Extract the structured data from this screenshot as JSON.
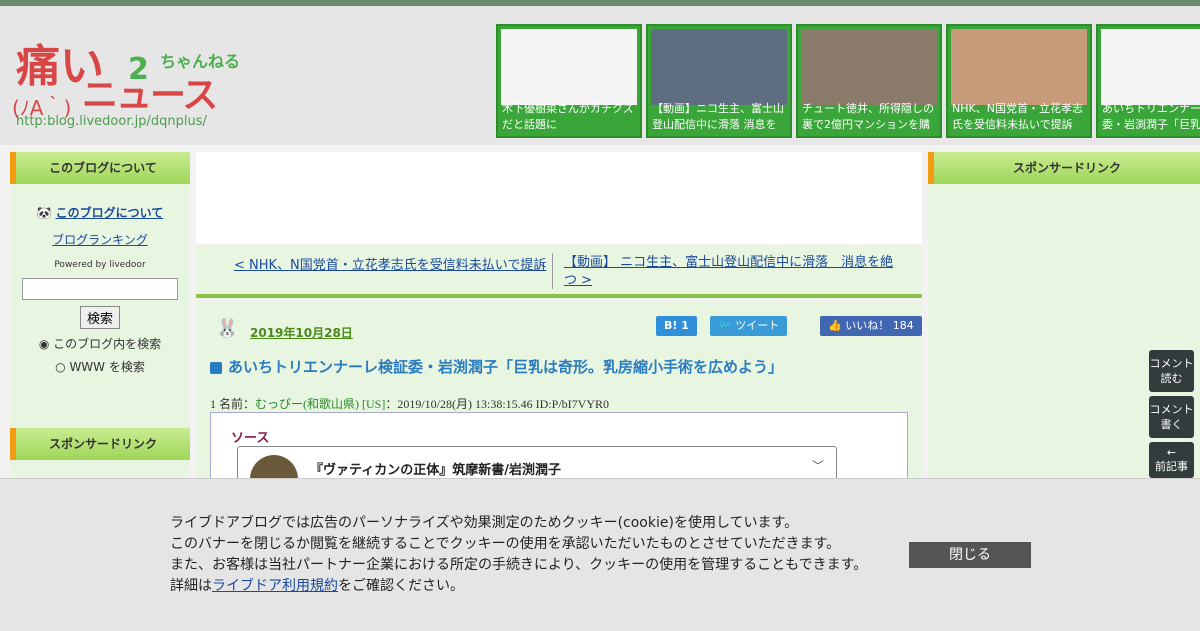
{
  "header": {
    "logo": {
      "kanji": "痛い",
      "face": "(ﾉA｀)",
      "news": "ニュース",
      "num": "2",
      "ch": "ちゃんねる",
      "url": "http:blog.livedoor.jp/dqnplus/"
    },
    "thumbs": [
      {
        "caption": "木下優樹菜さんがガチクズだと話題に",
        "bg": "#f4f4f4"
      },
      {
        "caption": "【動画】ニコ生主、富士山登山配信中に滑落 消息を",
        "bg": "#5e6d7f"
      },
      {
        "caption": "チュート徳井、所得隠しの裏で2億円マンションを購",
        "bg": "#8a7a6a"
      },
      {
        "caption": "NHK、N国党首・立花孝志氏を受信料未払いで提訴",
        "bg": "#c79a7a"
      },
      {
        "caption": "あいちトリエンナーレ検証委・岩渕潤子「巨乳",
        "bg": "#f4f4f4"
      }
    ]
  },
  "left_sidebar": {
    "title": "このブログについて",
    "about_link": "このブログについて",
    "ranking_link": "ブログランキング",
    "powered": "Powered by livedoor",
    "search_btn": "検索",
    "radio1": "このブログ内を検索",
    "radio2": "WWW を検索",
    "sponsor_title": "スポンサードリンク"
  },
  "right_sidebar": {
    "title": "スポンサードリンク"
  },
  "nav": {
    "prev": "< NHK、N国党首・立花孝志氏を受信料未払いで提訴",
    "next": "【動画】 ニコ生主、富士山登山配信中に滑落　消息を絶つ >"
  },
  "article": {
    "date": "2019年10月28日",
    "hatena": "B! 1",
    "tweet": "ツイート",
    "like": "いいね！ 184",
    "title": "あいちトリエンナーレ検証委・岩渕潤子「巨乳は奇形。乳房縮小手術を広めよう」",
    "meta_prefix": "1 名前：",
    "meta_name": "むっぴー(和歌山県) [US]",
    "meta_suffix": "：2019/10/28(月) 13:38:15.46 ID:P/bI7VYR0",
    "source_label": "ソース",
    "embed_title": "『ヴァティカンの正体』筑摩新書/岩渕潤子"
  },
  "float_buttons": {
    "comments_read": "コメント読む",
    "comments_write": "コメント書く",
    "prev_article": "前記事"
  },
  "cookie": {
    "line1": "ライブドアブログでは広告のパーソナライズや効果測定のためクッキー(cookie)を使用しています。",
    "line2": "このバナーを閉じるか閲覧を継続することでクッキーの使用を承認いただいたものとさせていただきます。",
    "line3": "また、お客様は当社パートナー企業における所定の手続きにより、クッキーの使用を管理することもできます。",
    "line4_prefix": "詳細は",
    "line4_link": "ライブドア利用規約",
    "line4_suffix": "をご確認ください。",
    "close": "閉じる"
  }
}
